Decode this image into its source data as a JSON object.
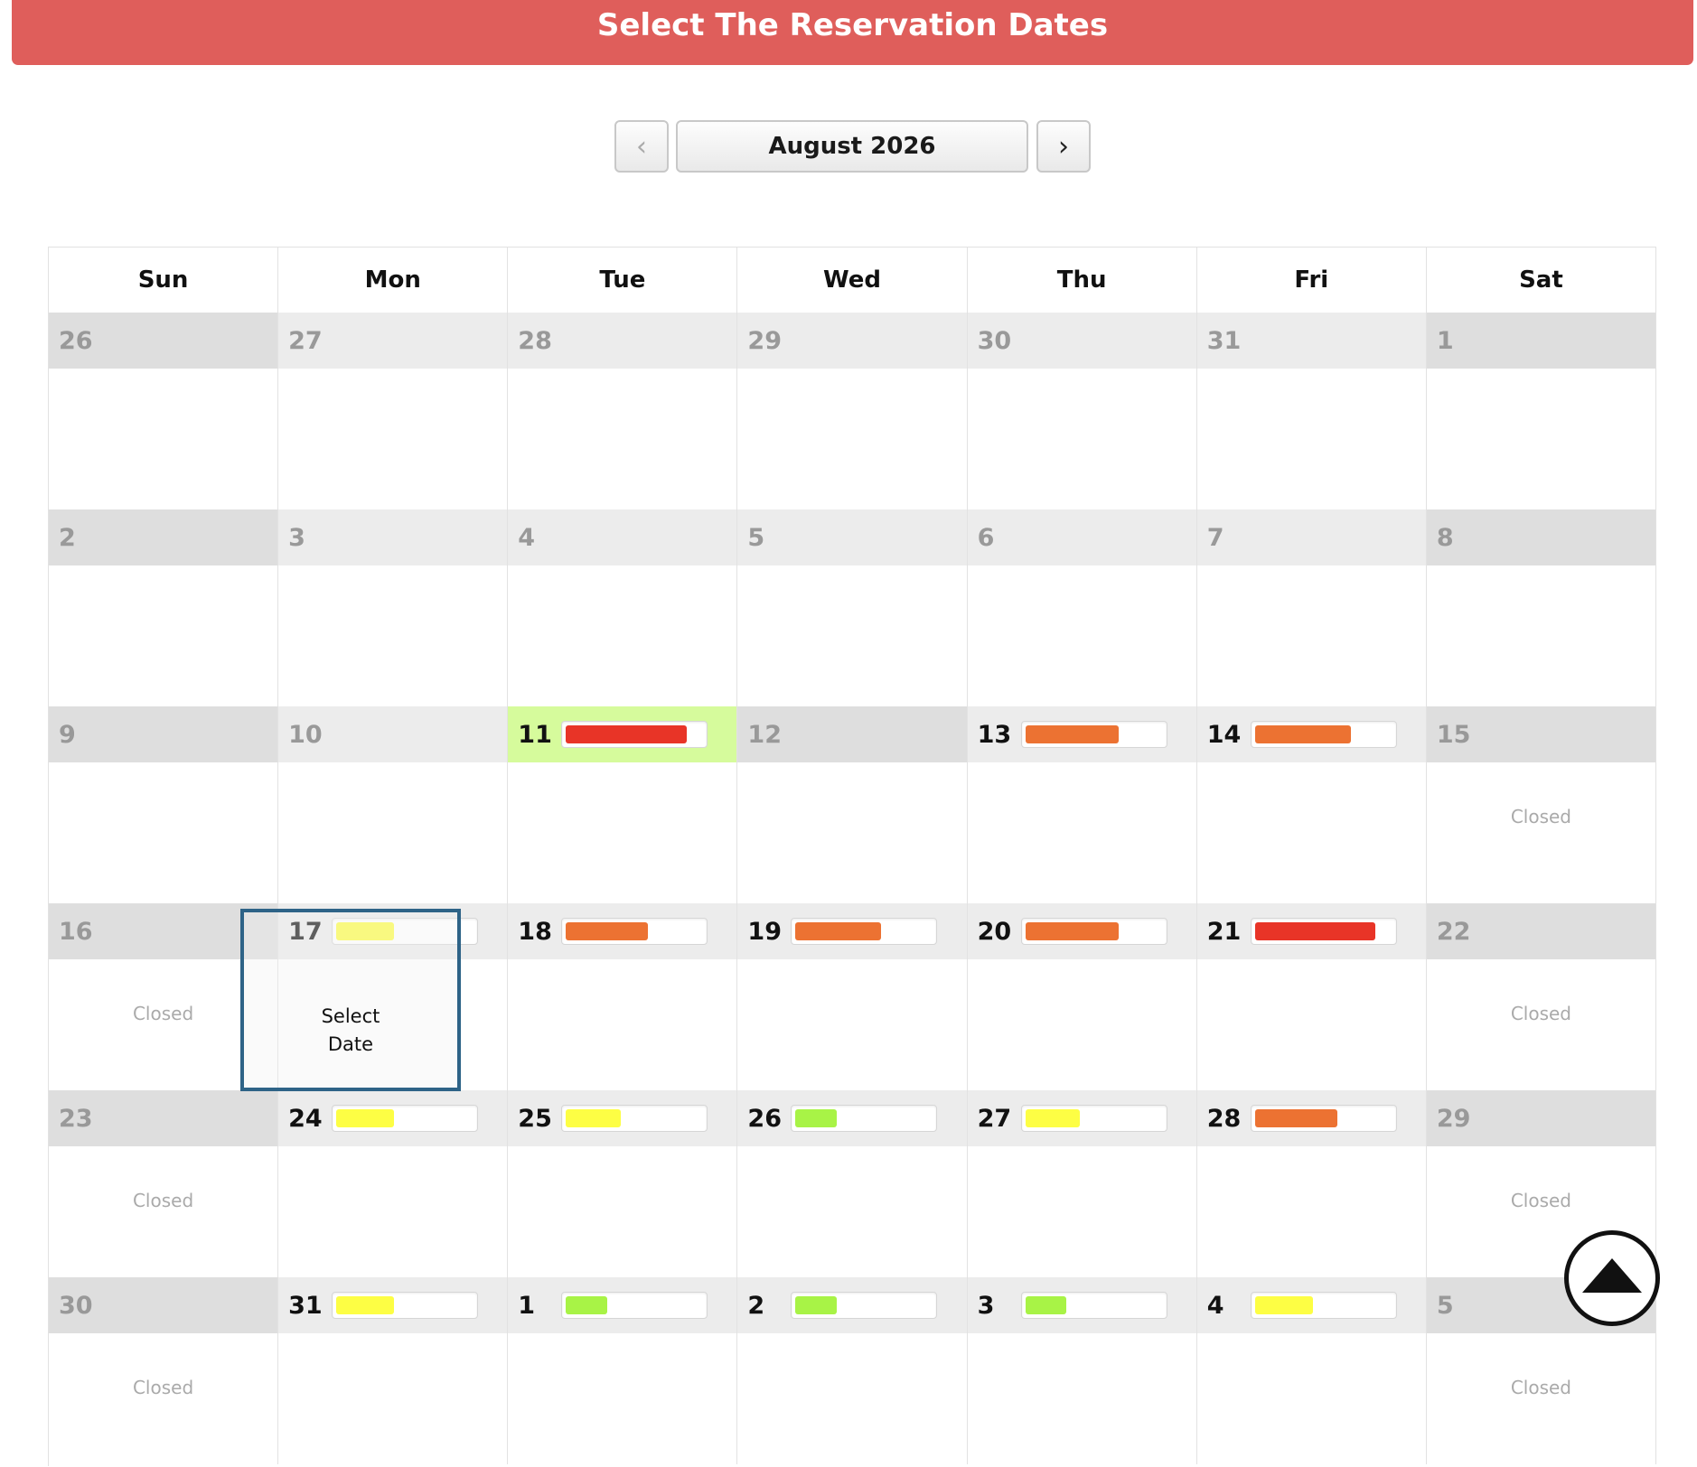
{
  "header": {
    "title": "Select The Reservation Dates"
  },
  "nav": {
    "prev_icon": "chevron-left-icon",
    "next_icon": "chevron-right-icon",
    "prev_glyph": "‹",
    "next_glyph": "›",
    "month_label": "August 2026"
  },
  "weekdays": [
    "Sun",
    "Mon",
    "Tue",
    "Wed",
    "Thu",
    "Fri",
    "Sat"
  ],
  "closed_label": "Closed",
  "select_label": "Select\nDate",
  "availability_colors": {
    "red": "#e83427",
    "orange": "#ec7232",
    "yellow": "#fdfe44",
    "green": "#a8f346"
  },
  "weeks": [
    [
      {
        "day": "26",
        "state": "past"
      },
      {
        "day": "27",
        "state": "past"
      },
      {
        "day": "28",
        "state": "past"
      },
      {
        "day": "29",
        "state": "past"
      },
      {
        "day": "30",
        "state": "past"
      },
      {
        "day": "31",
        "state": "past"
      },
      {
        "day": "1",
        "state": "past"
      }
    ],
    [
      {
        "day": "2",
        "state": "past"
      },
      {
        "day": "3",
        "state": "past"
      },
      {
        "day": "4",
        "state": "past"
      },
      {
        "day": "5",
        "state": "past"
      },
      {
        "day": "6",
        "state": "past"
      },
      {
        "day": "7",
        "state": "past"
      },
      {
        "day": "8",
        "state": "past"
      }
    ],
    [
      {
        "day": "9",
        "state": "past"
      },
      {
        "day": "10",
        "state": "past"
      },
      {
        "day": "11",
        "state": "today",
        "level": 0.88,
        "color": "red"
      },
      {
        "day": "12",
        "state": "unavail"
      },
      {
        "day": "13",
        "state": "open",
        "level": 0.68,
        "color": "orange"
      },
      {
        "day": "14",
        "state": "open",
        "level": 0.7,
        "color": "orange"
      },
      {
        "day": "15",
        "state": "closed"
      }
    ],
    [
      {
        "day": "16",
        "state": "closed"
      },
      {
        "day": "17",
        "state": "selected",
        "level": 0.42,
        "color": "yellow"
      },
      {
        "day": "18",
        "state": "open",
        "level": 0.6,
        "color": "orange"
      },
      {
        "day": "19",
        "state": "open",
        "level": 0.62,
        "color": "orange"
      },
      {
        "day": "20",
        "state": "open",
        "level": 0.68,
        "color": "orange"
      },
      {
        "day": "21",
        "state": "open",
        "level": 0.88,
        "color": "red"
      },
      {
        "day": "22",
        "state": "closed"
      }
    ],
    [
      {
        "day": "23",
        "state": "closed"
      },
      {
        "day": "24",
        "state": "open",
        "level": 0.42,
        "color": "yellow"
      },
      {
        "day": "25",
        "state": "open",
        "level": 0.4,
        "color": "yellow"
      },
      {
        "day": "26",
        "state": "open",
        "level": 0.3,
        "color": "green"
      },
      {
        "day": "27",
        "state": "open",
        "level": 0.4,
        "color": "yellow"
      },
      {
        "day": "28",
        "state": "open",
        "level": 0.6,
        "color": "orange"
      },
      {
        "day": "29",
        "state": "closed"
      }
    ],
    [
      {
        "day": "30",
        "state": "closed"
      },
      {
        "day": "31",
        "state": "open",
        "level": 0.42,
        "color": "yellow"
      },
      {
        "day": "1",
        "state": "open",
        "level": 0.3,
        "color": "green"
      },
      {
        "day": "2",
        "state": "open",
        "level": 0.3,
        "color": "green"
      },
      {
        "day": "3",
        "state": "open",
        "level": 0.3,
        "color": "green"
      },
      {
        "day": "4",
        "state": "open",
        "level": 0.42,
        "color": "yellow"
      },
      {
        "day": "5",
        "state": "closed"
      }
    ]
  ],
  "scroll_top": {
    "icon": "arrow-up-icon"
  }
}
